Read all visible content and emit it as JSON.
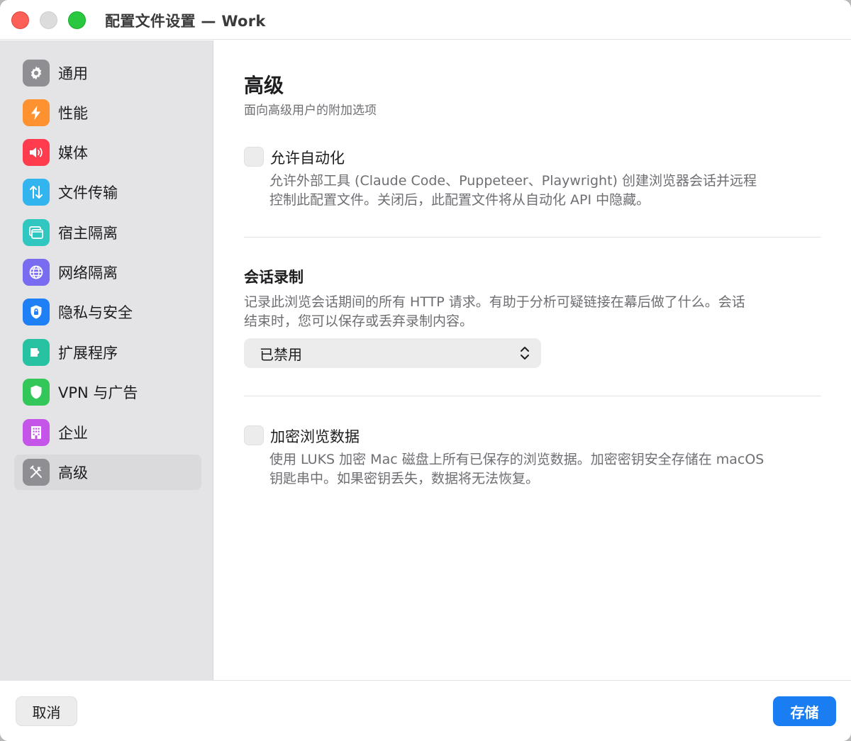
{
  "window": {
    "title": "配置文件设置 — Work"
  },
  "sidebar": {
    "items": [
      {
        "label": "通用",
        "icon": "gear-icon",
        "color": "#8e8e93"
      },
      {
        "label": "性能",
        "icon": "bolt-icon",
        "color": "#ff9230"
      },
      {
        "label": "媒体",
        "icon": "speaker-icon",
        "color": "#ff3b4e"
      },
      {
        "label": "文件传输",
        "icon": "transfer-arrows-icon",
        "color": "#32b4ef"
      },
      {
        "label": "宿主隔离",
        "icon": "window-stack-icon",
        "color": "#30c7c0"
      },
      {
        "label": "网络隔离",
        "icon": "globe-icon",
        "color": "#7a6cf0"
      },
      {
        "label": "隐私与安全",
        "icon": "lock-shield-icon",
        "color": "#1e80f4"
      },
      {
        "label": "扩展程序",
        "icon": "puzzle-icon",
        "color": "#26c2a2"
      },
      {
        "label": "VPN 与广告",
        "icon": "shield-icon",
        "color": "#33c759"
      },
      {
        "label": "企业",
        "icon": "building-icon",
        "color": "#c455e8"
      },
      {
        "label": "高级",
        "icon": "tools-icon",
        "color": "#8e8e93"
      }
    ],
    "active_index": 10
  },
  "main": {
    "title": "高级",
    "subtitle": "面向高级用户的附加选项",
    "automation": {
      "label": "允许自动化",
      "desc_line1": "允许外部工具 (Claude Code、Puppeteer、Playwright) 创建浏览器会话并远程",
      "desc_line2": "控制此配置文件。关闭后，此配置文件将从自动化 API 中隐藏。",
      "checked": false
    },
    "recording": {
      "title": "会话录制",
      "desc_line1": "记录此浏览会话期间的所有 HTTP 请求。有助于分析可疑链接在幕后做了什么。会话",
      "desc_line2": "结束时，您可以保存或丢弃录制内容。",
      "select_value": "已禁用"
    },
    "encryption": {
      "label": "加密浏览数据",
      "desc_line1": "使用 LUKS 加密 Mac 磁盘上所有已保存的浏览数据。加密密钥安全存储在 macOS",
      "desc_line2": "钥匙串中。如果密钥丢失，数据将无法恢复。",
      "checked": false
    }
  },
  "footer": {
    "cancel_label": "取消",
    "save_label": "存储"
  },
  "colors": {
    "accent": "#1a7ef2"
  }
}
